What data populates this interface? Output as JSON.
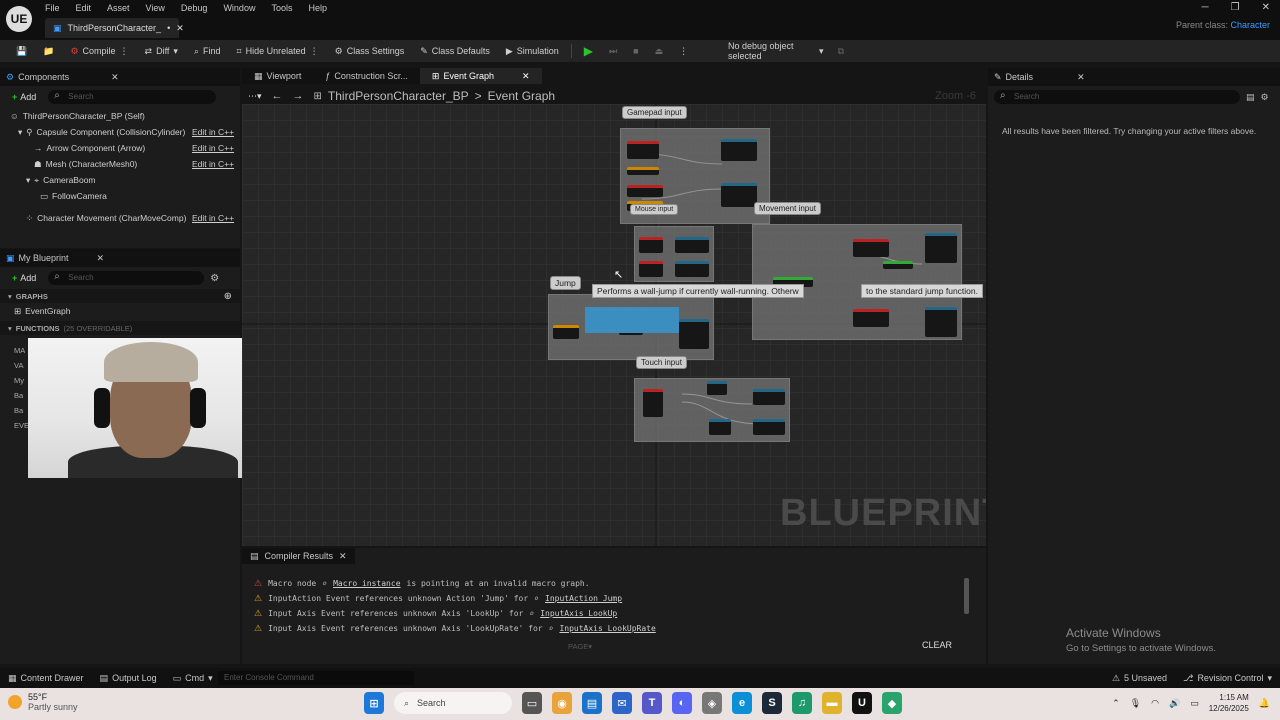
{
  "app": {
    "logo": "UE",
    "menu": [
      "File",
      "Edit",
      "Asset",
      "View",
      "Debug",
      "Window",
      "Tools",
      "Help"
    ],
    "doc_tab": "ThirdPersonCharacter_",
    "doc_tab_marker": "•",
    "parent_class_label": "Parent class:",
    "parent_class_value": "Character"
  },
  "toolbar": {
    "compile": "Compile",
    "diff": "Diff",
    "find": "Find",
    "hide_unrelated": "Hide Unrelated",
    "class_settings": "Class Settings",
    "class_defaults": "Class Defaults",
    "simulation": "Simulation",
    "debug_object": "No debug object selected"
  },
  "components": {
    "tab_label": "Components",
    "add_label": "Add",
    "search_placeholder": "Search",
    "items": [
      {
        "label": "ThirdPersonCharacter_BP (Self)",
        "edit": ""
      },
      {
        "label": "Capsule Component (CollisionCylinder)",
        "edit": "Edit in C++"
      },
      {
        "label": "Arrow Component (Arrow)",
        "edit": "Edit in C++"
      },
      {
        "label": "Mesh (CharacterMesh0)",
        "edit": "Edit in C++"
      },
      {
        "label": "CameraBoom",
        "edit": ""
      },
      {
        "label": "FollowCamera",
        "edit": ""
      },
      {
        "label": "Character Movement (CharMoveComp)",
        "edit": "Edit in C++"
      }
    ]
  },
  "my_blueprint": {
    "tab_label": "My Blueprint",
    "add_label": "Add",
    "search_placeholder": "Search",
    "graphs_header": "GRAPHS",
    "event_graph": "EventGraph",
    "functions_header": "FUNCTIONS",
    "functions_suffix": "(25 OVERRIDABLE)",
    "side_letters": [
      "MA",
      "VA",
      "My",
      "Ba",
      "Ba",
      "EVE"
    ]
  },
  "center_tabs": [
    {
      "label": "Viewport",
      "active": false
    },
    {
      "label": "Construction Scr...",
      "active": false
    },
    {
      "label": "Event Graph",
      "active": true
    }
  ],
  "graph": {
    "breadcrumb_bp": "ThirdPersonCharacter_BP",
    "breadcrumb_sep": ">",
    "breadcrumb_graph": "Event Graph",
    "zoom": "Zoom -6",
    "watermark": "BLUEPRINT",
    "comments": {
      "gamepad": "Gamepad input",
      "mouse": "Mouse input",
      "movement": "Movement input",
      "jump": "Jump",
      "touch": "Touch input"
    },
    "tooltip_start": "Performs a wall-jump if currently wall-running. Otherw",
    "tooltip_end": "to the standard jump function."
  },
  "compiler": {
    "tab_label": "Compiler Results",
    "messages": [
      {
        "text": "Macro node",
        "link_pre": "",
        "link": "Macro instance",
        "post": "is pointing at an invalid macro graph."
      },
      {
        "text": "InputAction Event references unknown Action 'Jump' for",
        "link": "InputAction Jump",
        "post": ""
      },
      {
        "text": "Input Axis Event references unknown Axis 'LookUp' for",
        "link": "InputAxis LookUp",
        "post": ""
      },
      {
        "text": "Input Axis Event references unknown Axis 'LookUpRate' for",
        "link": "InputAxis LookUpRate",
        "post": ""
      }
    ],
    "page_label": "PAGE",
    "clear_label": "CLEAR"
  },
  "details": {
    "tab_label": "Details",
    "search_placeholder": "Search",
    "filtered_msg": "All results have been filtered. Try changing your active filters above."
  },
  "watermark_windows": {
    "title": "Activate Windows",
    "subtitle": "Go to Settings to activate Windows."
  },
  "statusbar": {
    "content_drawer": "Content Drawer",
    "output_log": "Output Log",
    "cmd": "Cmd",
    "console_placeholder": "Enter Console Command",
    "unsaved": "5 Unsaved",
    "revision_control": "Revision Control"
  },
  "taskbar": {
    "temperature": "55°F",
    "weather": "Partly sunny",
    "search": "Search",
    "time": "1:15 AM",
    "date": "12/26/2025"
  },
  "colors": {
    "accent_blue": "#3f9bff",
    "play_green": "#2ec12e",
    "warning": "#e0a020"
  }
}
